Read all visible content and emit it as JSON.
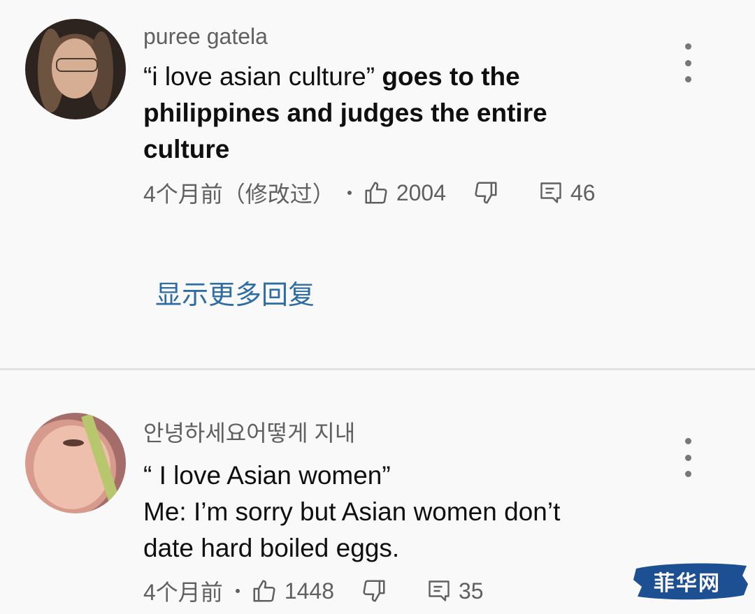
{
  "comments": [
    {
      "author": "puree gatela",
      "text_quote": "“i love asian culture”",
      "text_line1_rest": " goes to the",
      "text_line2": "philippines and judges the entire",
      "text_line3": "culture",
      "timestamp": "4个月前（修改过）",
      "likes": "2004",
      "replies": "46",
      "more_replies_label": "显示更多回复"
    },
    {
      "author": "안녕하세요어떻게 지내",
      "text_line1": "“ I love Asian women”",
      "text_line2": "Me: I’m sorry but Asian women don’t",
      "text_line3": "date hard boiled eggs.",
      "timestamp": "4个月前",
      "likes": "1448",
      "replies": "35"
    }
  ],
  "watermark": {
    "text": "菲华网",
    "color": "#1d4f93"
  },
  "colors": {
    "background": "#f9f9f9",
    "meta_text": "#606060",
    "link": "#2e6ca4",
    "divider": "#e2e2e2"
  },
  "icons": [
    "thumbs-up-icon",
    "thumbs-down-icon",
    "reply-comment-icon",
    "more-vert-icon"
  ]
}
